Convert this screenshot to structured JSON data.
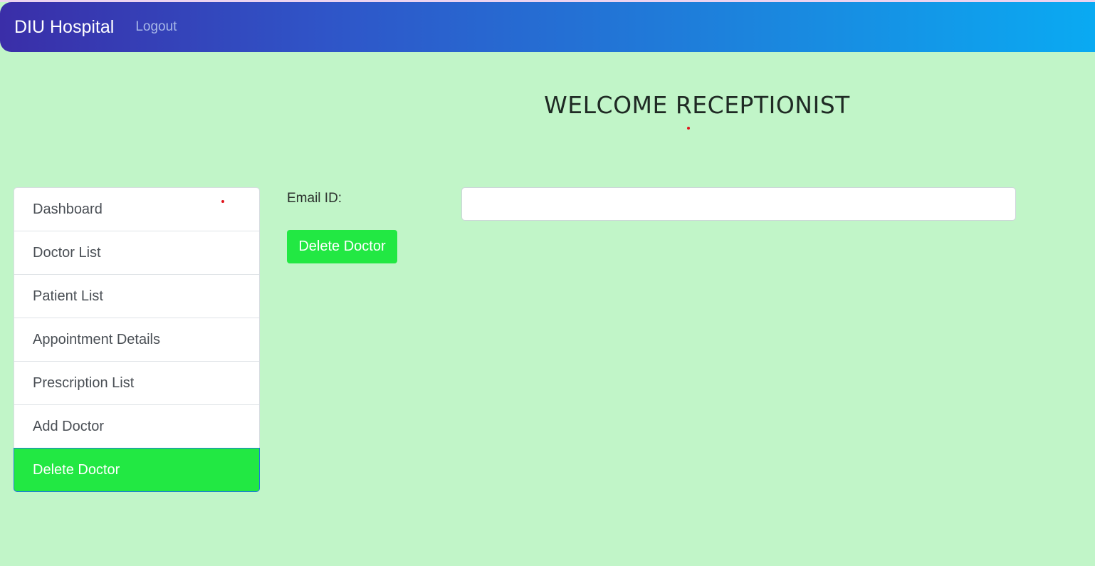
{
  "navbar": {
    "brand": "DIU Hospital",
    "logout_label": "Logout"
  },
  "page": {
    "title": "WELCOME RECEPTIONIST"
  },
  "sidebar": {
    "items": [
      {
        "label": "Dashboard",
        "active": false
      },
      {
        "label": "Doctor List",
        "active": false
      },
      {
        "label": "Patient List",
        "active": false
      },
      {
        "label": "Appointment Details",
        "active": false
      },
      {
        "label": "Prescription List",
        "active": false
      },
      {
        "label": "Add Doctor",
        "active": false
      },
      {
        "label": "Delete Doctor",
        "active": true
      }
    ]
  },
  "form": {
    "email_label": "Email ID:",
    "email_value": "",
    "submit_label": "Delete Doctor"
  },
  "colors": {
    "background": "#c1f5c8",
    "accent_green": "#22e843",
    "navbar_gradient_start": "#3a2ea8",
    "navbar_gradient_end": "#0aaaf2"
  }
}
